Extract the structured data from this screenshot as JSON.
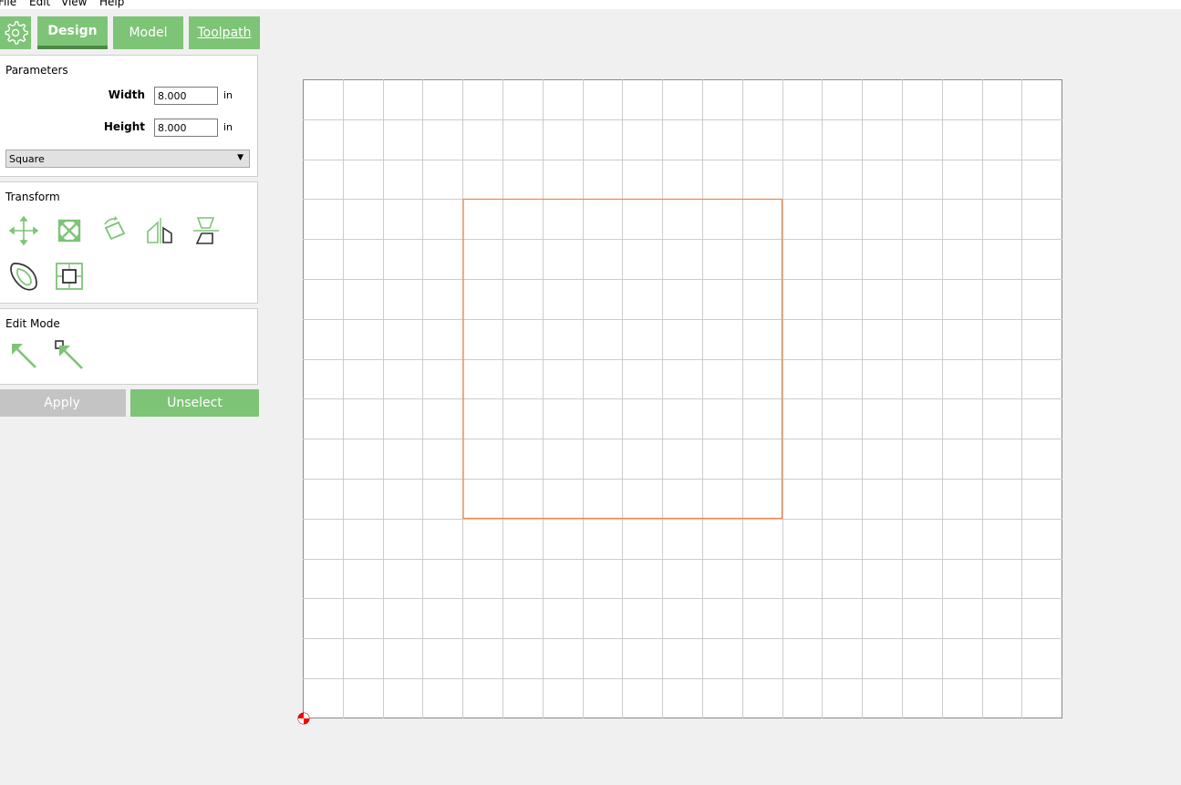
{
  "menu": {
    "items": [
      "File",
      "Edit",
      "View",
      "Help"
    ]
  },
  "tabs": {
    "settings_icon": "gear-icon",
    "design": "Design",
    "model": "Model",
    "toolpath": "Toolpath"
  },
  "parameters": {
    "title": "Parameters",
    "width_label": "Width",
    "width_value": "8.000",
    "width_unit": "in",
    "height_label": "Height",
    "height_value": "8.000",
    "height_unit": "in",
    "shape_selected": "Square"
  },
  "transform": {
    "title": "Transform",
    "tools": [
      "move-icon",
      "scale-icon",
      "rotate-icon",
      "mirror-horizontal-icon",
      "mirror-vertical-icon",
      "offset-icon",
      "align-center-icon"
    ]
  },
  "edit_mode": {
    "title": "Edit Mode",
    "tools": [
      "select-arrow-icon",
      "node-edit-arrow-icon"
    ]
  },
  "actions": {
    "apply": "Apply",
    "unselect": "Unselect"
  },
  "colors": {
    "accent": "#7dc476",
    "accent_dark": "#4b8a45",
    "disabled": "#c4c4c4",
    "shape_stroke": "#f08a4b",
    "origin": "#ff0000"
  }
}
